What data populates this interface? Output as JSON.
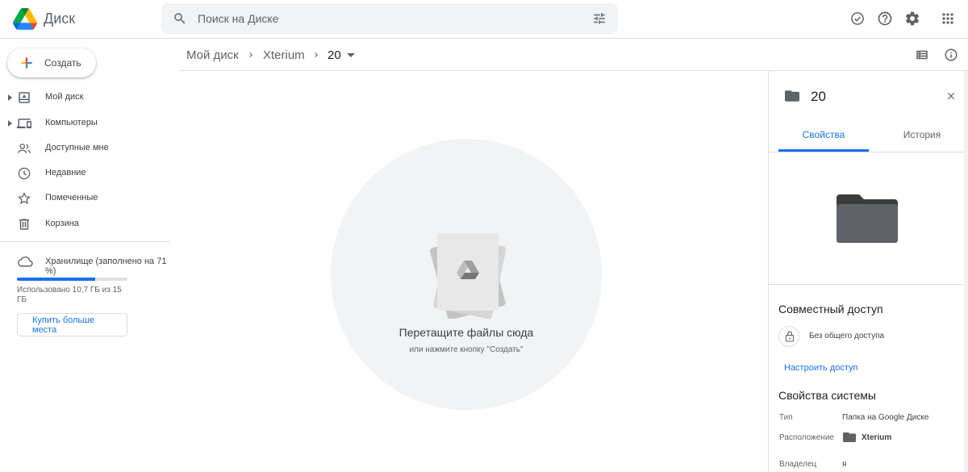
{
  "header": {
    "app_title": "Диск",
    "search_placeholder": "Поиск на Диске",
    "icons": [
      "google-drive-logo",
      "search-icon",
      "tune-icon",
      "offline-check-icon",
      "help-icon",
      "settings-icon",
      "apps-grid-icon"
    ]
  },
  "sidebar": {
    "create_label": "Создать",
    "items": [
      {
        "label": "Мой диск",
        "icon": "my-drive-icon",
        "expandable": true
      },
      {
        "label": "Компьютеры",
        "icon": "computers-icon",
        "expandable": true
      },
      {
        "label": "Доступные мне",
        "icon": "shared-with-me-icon",
        "expandable": false
      },
      {
        "label": "Недавние",
        "icon": "recent-icon",
        "expandable": false
      },
      {
        "label": "Помеченные",
        "icon": "star-icon",
        "expandable": false
      },
      {
        "label": "Корзина",
        "icon": "trash-icon",
        "expandable": false
      }
    ],
    "storage": {
      "title": "Хранилище (заполнено на 71 %)",
      "percent_used": 71,
      "usage_text": "Использовано 10,7 ГБ из 15 ГБ",
      "buy_label": "Купить больше места"
    }
  },
  "breadcrumb": {
    "items": [
      "Мой диск",
      "Xterium",
      "20"
    ]
  },
  "main": {
    "empty_title": "Перетащите файлы сюда",
    "empty_subtitle": "или нажмите кнопку \"Создать\""
  },
  "details": {
    "title": "20",
    "tabs": {
      "properties": "Свойства",
      "history": "История"
    },
    "sharing_title": "Совместный доступ",
    "access_status": "Без общего доступа",
    "manage_access": "Настроить доступ",
    "system_props_title": "Свойства системы",
    "props": {
      "type_label": "Тип",
      "type_value": "Папка на Google Диске",
      "location_label": "Расположение",
      "location_value": "Xterium",
      "owner_label": "Владелец",
      "owner_value": "я"
    }
  },
  "colors": {
    "accent": "#1a73e8",
    "folder": "#5f6368",
    "search_bg": "#f1f3f4"
  }
}
